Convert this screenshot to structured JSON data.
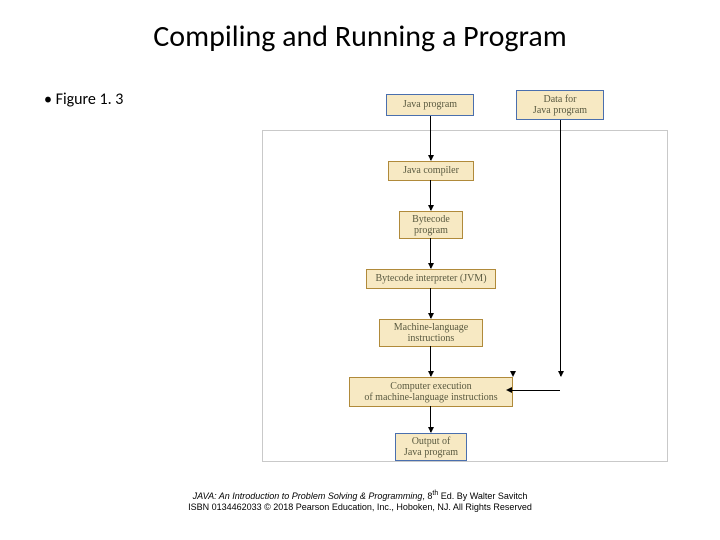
{
  "title": "Compiling and Running a Program",
  "bullet": "Figure 1. 3",
  "boxes": {
    "java_program": "Java program",
    "data_for": "Data for\nJava program",
    "compiler": "Java compiler",
    "bytecode": "Bytecode\nprogram",
    "interpreter": "Bytecode interpreter (JVM)",
    "machine_lang": "Machine-language\ninstructions",
    "execution": "Computer execution\nof machine-language instructions",
    "output": "Output of\nJava program"
  },
  "footer": {
    "line1_pre": "JAVA: An Introduction to Problem Solving & Programming",
    "line1_post_pre": ", 8",
    "line1_sup": "th",
    "line1_tail": " Ed. By Walter Savitch",
    "line2": "ISBN 0134462033 © 2018 Pearson Education, Inc., Hoboken, NJ. All Rights Reserved"
  }
}
